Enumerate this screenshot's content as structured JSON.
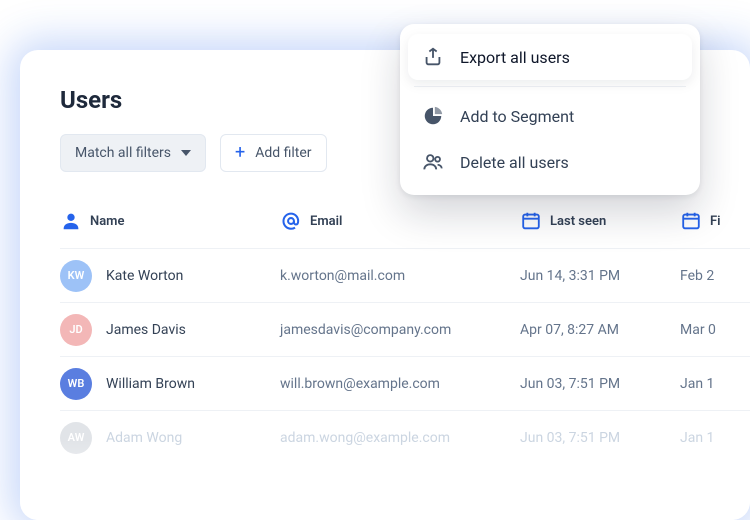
{
  "title": "Users",
  "filters": {
    "match_label": "Match all filters",
    "add_label": "Add filter"
  },
  "columns": {
    "name": "Name",
    "email": "Email",
    "last_seen": "Last seen",
    "first_seen": "Fi"
  },
  "rows": [
    {
      "initials": "KW",
      "avatar_color": "#9dc2f7",
      "name": "Kate Worton",
      "email": "k.worton@mail.com",
      "last_seen": "Jun 14, 3:31 PM",
      "first_seen": "Feb 2"
    },
    {
      "initials": "JD",
      "avatar_color": "#f3b7b7",
      "name": "James Davis",
      "email": "jamesdavis@company.com",
      "last_seen": "Apr 07, 8:27 AM",
      "first_seen": "Mar 0"
    },
    {
      "initials": "WB",
      "avatar_color": "#5a7ee0",
      "name": "William Brown",
      "email": "will.brown@example.com",
      "last_seen": "Jun 03, 7:51 PM",
      "first_seen": "Jan 1"
    },
    {
      "initials": "AW",
      "avatar_color": "#c9ced6",
      "name": "Adam Wong",
      "email": "adam.wong@example.com",
      "last_seen": "Jun 03, 7:51 PM",
      "first_seen": "Jan 1"
    }
  ],
  "menu": {
    "export": "Export all users",
    "segment": "Add to Segment",
    "delete": "Delete all users"
  }
}
